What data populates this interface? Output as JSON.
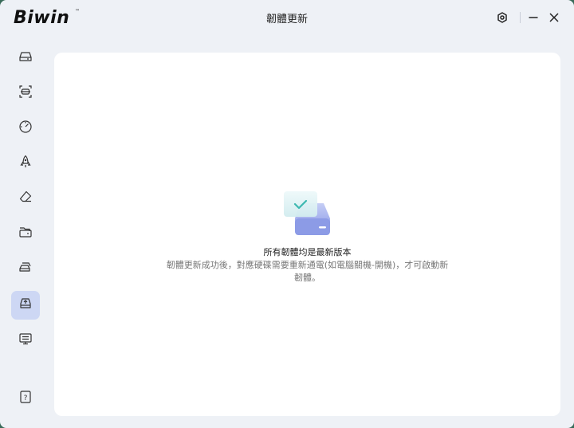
{
  "app": {
    "logo_text": "Biwin",
    "logo_tm": "™",
    "title": "韌體更新"
  },
  "titlebar": {
    "icons": [
      "settings-icon",
      "minimize-icon",
      "close-icon"
    ]
  },
  "sidebar": {
    "items": [
      {
        "icon": "drive-icon",
        "active": false
      },
      {
        "icon": "scan-icon",
        "active": false
      },
      {
        "icon": "speedometer-icon",
        "active": false
      },
      {
        "icon": "rocket-icon",
        "active": false
      },
      {
        "icon": "eraser-icon",
        "active": false
      },
      {
        "icon": "folder-drive-icon",
        "active": false
      },
      {
        "icon": "clone-drive-icon",
        "active": false
      },
      {
        "icon": "firmware-update-icon",
        "active": true
      },
      {
        "icon": "monitor-info-icon",
        "active": false
      }
    ],
    "help_icon": "help-icon"
  },
  "main": {
    "status_title": "所有韌體均是最新版本",
    "status_body": "韌體更新成功後，對應硬碟需要重新通電(如電腦關機-開機)，才可啟動新韌體。"
  },
  "colors": {
    "accent": "#cdd7f4",
    "drive_blue": "#8a9bea",
    "check": "#3db8b0"
  }
}
